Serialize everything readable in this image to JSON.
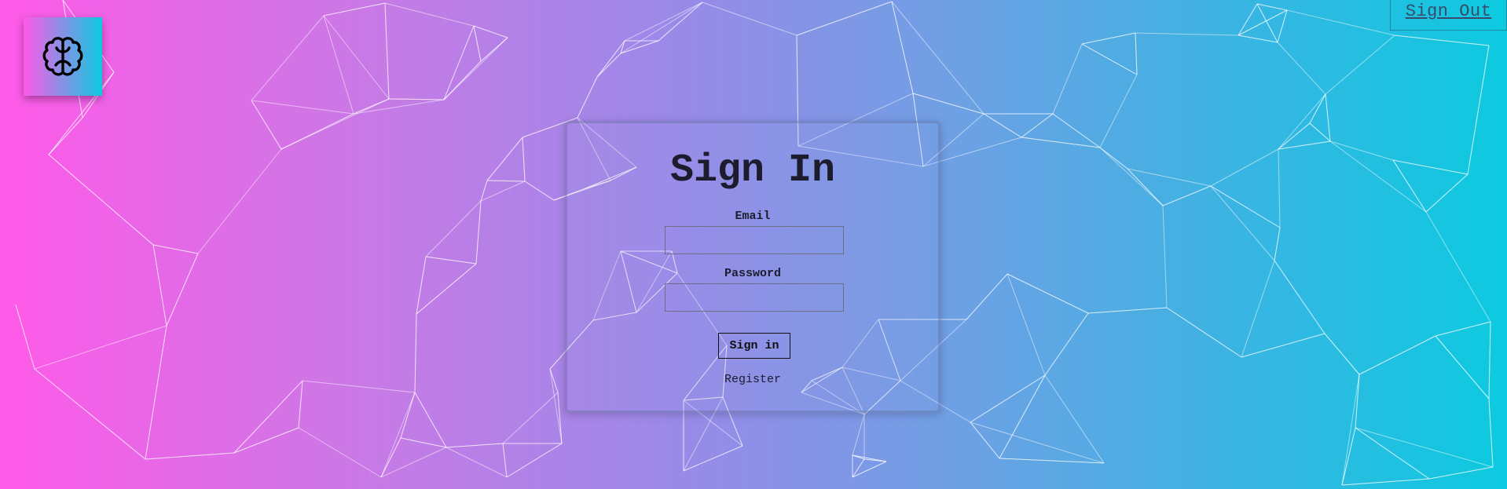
{
  "header": {
    "logo_icon": "brain-icon",
    "sign_out_label": "Sign Out"
  },
  "form": {
    "title": "Sign In",
    "email_label": "Email",
    "email_value": "",
    "password_label": "Password",
    "password_value": "",
    "submit_label": "Sign in",
    "register_label": "Register"
  },
  "theme": {
    "gradient_start": "#ff5ae8",
    "gradient_end": "#0ccae0",
    "text_color": "#1c1c2e"
  }
}
